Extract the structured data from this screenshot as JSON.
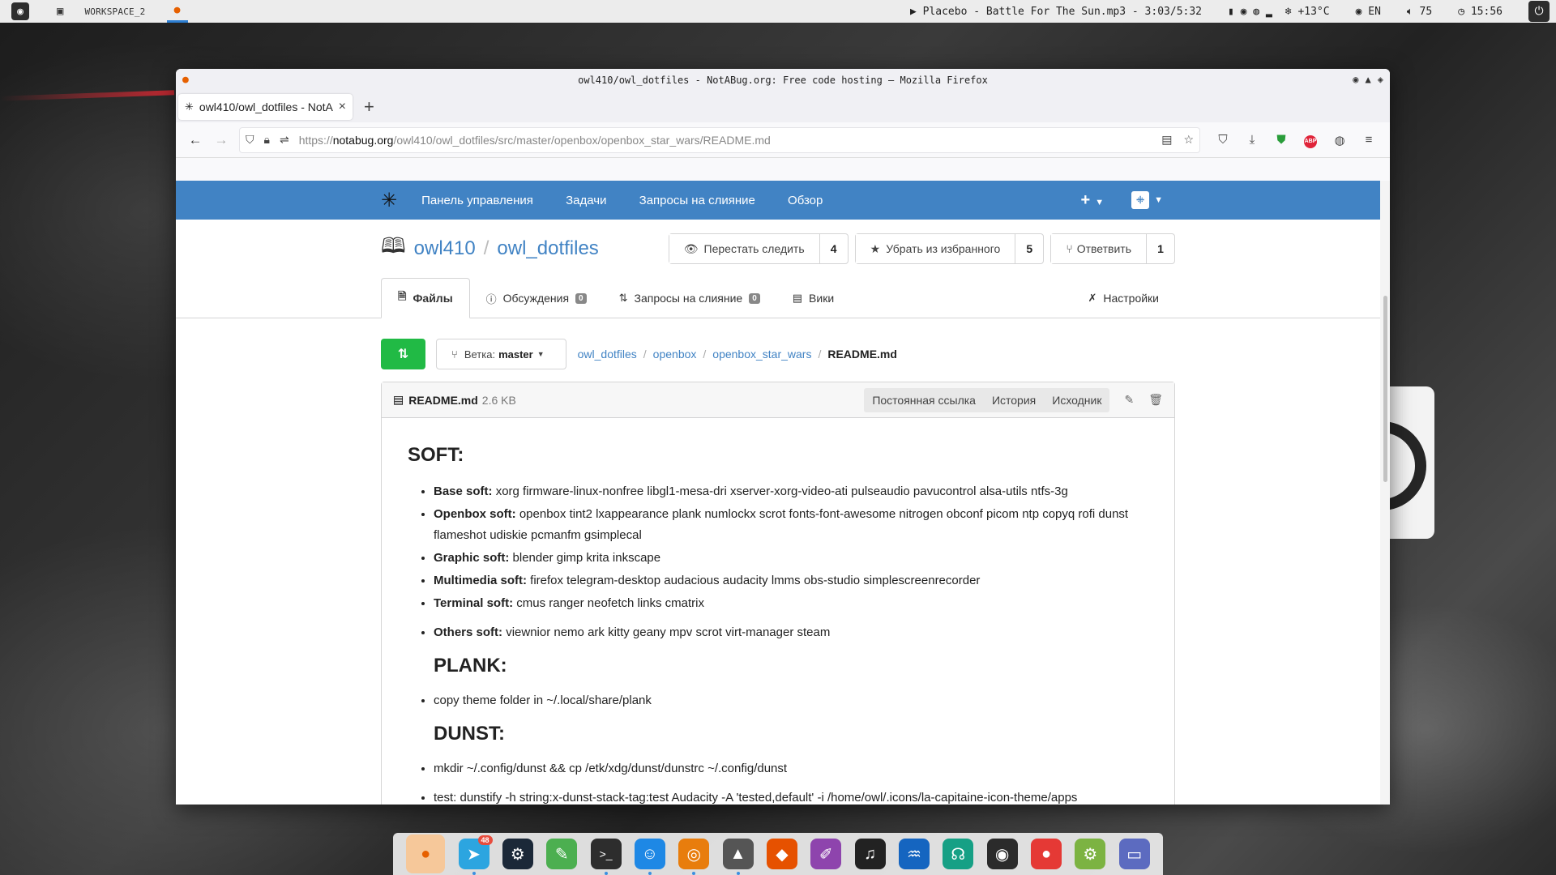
{
  "topbar": {
    "workspace": "WORKSPACE_2",
    "music": "Placebo - Battle For The Sun.mp3 - 3:03/5:32",
    "weather": "+13°C",
    "lang": "EN",
    "volume": "75",
    "clock": "15:56"
  },
  "window": {
    "title": "owl410/owl_dotfiles - NotABug.org: Free code hosting — Mozilla Firefox",
    "tab_title": "owl410/owl_dotfiles - NotA",
    "url_prefix": "https://",
    "url_host": "notabug.org",
    "url_path": "/owl410/owl_dotfiles/src/master/openbox/openbox_star_wars/README.md"
  },
  "site": {
    "nav": [
      "Панель управления",
      "Задачи",
      "Запросы на слияние",
      "Обзор"
    ],
    "avatar": "ꔰ"
  },
  "repo": {
    "owner": "owl410",
    "name": "owl_dotfiles",
    "unwatch_label": "Перестать следить",
    "watch_count": "4",
    "unstar_label": "Убрать из избранного",
    "star_count": "5",
    "fork_label": "Ответвить",
    "fork_count": "1"
  },
  "tabs": {
    "files": "Файлы",
    "issues": "Обсуждения",
    "issues_count": "0",
    "pulls": "Запросы на слияние",
    "pulls_count": "0",
    "wiki": "Вики",
    "settings": "Настройки"
  },
  "filebar": {
    "branch_label": "Ветка:",
    "branch": "master",
    "crumbs": [
      "owl_dotfiles",
      "openbox",
      "openbox_star_wars"
    ],
    "current": "README.md"
  },
  "file": {
    "name": "README.md",
    "size": "2.6 KB",
    "permalink": "Постоянная ссылка",
    "history": "История",
    "raw": "Исходник"
  },
  "readme": {
    "h_soft": "SOFT:",
    "soft": [
      {
        "label": "Base soft:",
        "text": "xorg firmware-linux-nonfree libgl1-mesa-dri xserver-xorg-video-ati pulseaudio pavucontrol alsa-utils ntfs-3g"
      },
      {
        "label": "Openbox soft:",
        "text": "openbox tint2 lxappearance plank numlockx scrot fonts-font-awesome nitrogen obconf picom ntp copyq rofi dunst flameshot udiskie pcmanfm gsimplecal"
      },
      {
        "label": "Graphic soft:",
        "text": "blender gimp krita inkscape"
      },
      {
        "label": "Multimedia soft:",
        "text": "firefox telegram-desktop audacious audacity lmms obs-studio simplescreenrecorder"
      },
      {
        "label": "Terminal soft:",
        "text": "cmus ranger neofetch links cmatrix"
      },
      {
        "label": "Others soft:",
        "text": "viewnior nemo ark kitty geany mpv scrot virt-manager steam"
      }
    ],
    "h_plank": "PLANK:",
    "plank": "copy theme folder in ~/.local/share/plank",
    "h_dunst": "DUNST:",
    "dunst1": "mkdir ~/.config/dunst && cp /etk/xdg/dunst/dunstrc ~/.config/dunst",
    "dunst2": "test: dunstify -h string:x-dunst-stack-tag:test Audacity -A 'tested,default' -i /home/owl/.icons/la-capitaine-icon-theme/apps"
  },
  "dock": {
    "telegram_badge": "48",
    "apps": [
      "firefox",
      "telegram",
      "steam",
      "geany",
      "terminal",
      "file-manager",
      "blender",
      "inkscape",
      "gimp",
      "krita",
      "music",
      "audacity",
      "headphones",
      "obs",
      "record",
      "settings",
      "virt-manager"
    ],
    "colors": {
      "firefox": "#f6c89a",
      "telegram": "#2ca5e0",
      "steam": "#1b2838",
      "geany": "#4caf50",
      "terminal": "#2d2d2d",
      "file-manager": "#1e88e5",
      "blender": "#e87d0d",
      "inkscape": "#555555",
      "gimp": "#e65100",
      "krita": "#8e44ad",
      "music": "#222222",
      "audacity": "#1565c0",
      "headphones": "#16a085",
      "obs": "#2b2b2b",
      "record": "#e53935",
      "settings": "#7cb342",
      "virt-manager": "#5c6bc0"
    }
  }
}
